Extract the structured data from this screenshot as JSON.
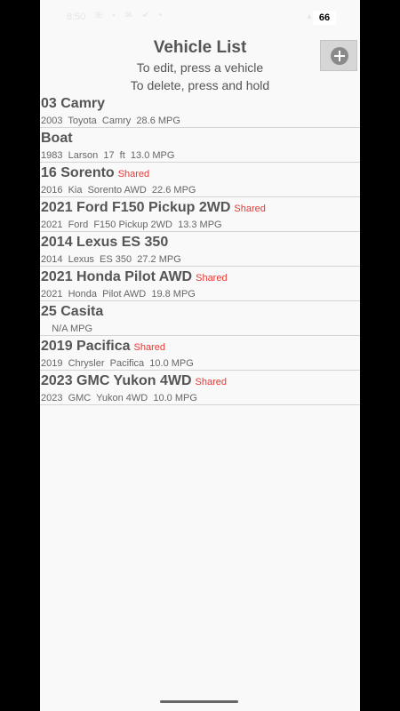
{
  "status_bar": {
    "time": "8:50",
    "notification_icons": "⊞ ▪ ✉ ✔ •",
    "system_icons": "▴▮ ◔",
    "battery": "66"
  },
  "header": {
    "title": "Vehicle List",
    "instruction_edit": "To edit, press a vehicle",
    "instruction_delete": "To delete, press and hold"
  },
  "add_button": {
    "icon": "plus-circle-icon"
  },
  "shared_label": "Shared",
  "vehicles": [
    {
      "name": "03 Camry",
      "shared": "",
      "detail": "2003  Toyota  Camry  28.6 MPG"
    },
    {
      "name": "Boat",
      "shared": "",
      "detail": "1983  Larson  17  ft  13.0 MPG"
    },
    {
      "name": "16 Sorento",
      "shared": "Shared",
      "detail": "2016  Kia  Sorento AWD  22.6 MPG"
    },
    {
      "name": "2021 Ford F150 Pickup 2WD",
      "shared": "Shared",
      "detail": "2021  Ford  F150 Pickup 2WD  13.3 MPG"
    },
    {
      "name": "2014 Lexus ES 350",
      "shared": "",
      "detail": "2014  Lexus  ES 350  27.2 MPG"
    },
    {
      "name": "2021 Honda Pilot AWD",
      "shared": "Shared",
      "detail": "2021  Honda  Pilot AWD  19.8 MPG"
    },
    {
      "name": "25 Casita",
      "shared": "",
      "detail": "    N/A MPG"
    },
    {
      "name": "2019 Pacifica",
      "shared": "Shared",
      "detail": "2019  Chrysler  Pacifica  10.0 MPG"
    },
    {
      "name": "2023 GMC Yukon 4WD",
      "shared": "Shared",
      "detail": "2023  GMC  Yukon 4WD  10.0 MPG"
    }
  ]
}
